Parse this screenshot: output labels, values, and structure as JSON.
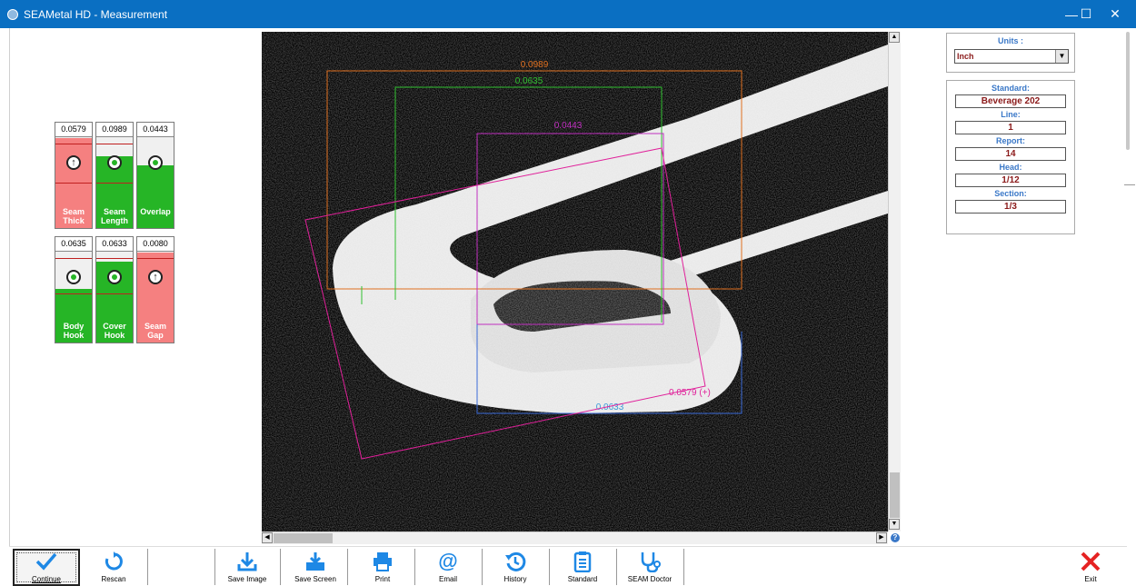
{
  "window": {
    "title": "SEAMetal HD - Measurement",
    "minimize": "—",
    "maximize": "☐",
    "close": "✕"
  },
  "gauges": [
    {
      "value": "0.0579",
      "label_line1": "Seam",
      "label_line2": "Thick",
      "status": "fail",
      "marker": "up"
    },
    {
      "value": "0.0989",
      "label_line1": "Seam",
      "label_line2": "Length",
      "status": "pass",
      "marker": "ok"
    },
    {
      "value": "0.0443",
      "label_line1": "Overlap",
      "label_line2": "",
      "status": "pass",
      "marker": "ok"
    },
    {
      "value": "0.0635",
      "label_line1": "Body",
      "label_line2": "Hook",
      "status": "pass",
      "marker": "ok"
    },
    {
      "value": "0.0633",
      "label_line1": "Cover",
      "label_line2": "Hook",
      "status": "pass",
      "marker": "ok"
    },
    {
      "value": "0.0080",
      "label_line1": "Seam",
      "label_line2": "Gap",
      "status": "fail",
      "marker": "up"
    }
  ],
  "measurements": {
    "seam_length": "0.0989",
    "body_hook": "0.0635",
    "overlap": "0.0443",
    "cover_hook": "0.0633",
    "seam_thickness": "0.0579 (+)"
  },
  "colors": {
    "seam_length": "#e07020",
    "body_hook": "#30c030",
    "overlap": "#c030c0",
    "cover_hook": "#3a6ad8",
    "seam_thickness": "#e0209a",
    "pass": "#26b526",
    "fail": "#f58080",
    "title_bar": "#0a6fc2",
    "value_text": "#8b1a1a",
    "header_text": "#3a78c8"
  },
  "units": {
    "label": "Units :",
    "selected": "Inch"
  },
  "info": {
    "standard_label": "Standard:",
    "standard": "Beverage 202",
    "line_label": "Line:",
    "line": "1",
    "report_label": "Report:",
    "report": "14",
    "head_label": "Head:",
    "head": "1/12",
    "section_label": "Section:",
    "section": "1/3"
  },
  "toolbar": {
    "continue": "Continue",
    "rescan": "Rescan",
    "save_image": "Save Image",
    "save_screen": "Save Screen",
    "print": "Print",
    "email": "Email",
    "history": "History",
    "standard": "Standard",
    "seam_doctor": "SEAM Doctor",
    "exit": "Exit"
  }
}
